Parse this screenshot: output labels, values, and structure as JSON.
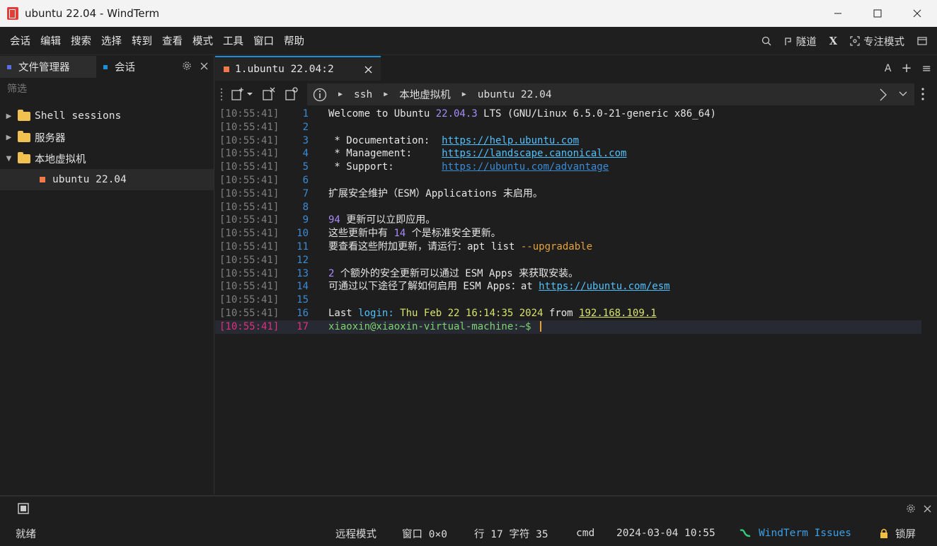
{
  "window": {
    "title": "ubuntu 22.04 - WindTerm"
  },
  "menu": {
    "items": [
      "会话",
      "编辑",
      "搜索",
      "选择",
      "转到",
      "查看",
      "模式",
      "工具",
      "窗口",
      "帮助"
    ],
    "tunnel_label": "隧道",
    "x_label": "X",
    "focus_label": "专注模式"
  },
  "left_panel": {
    "tabs": [
      {
        "label": "文件管理器",
        "color": "#5b6ee1"
      },
      {
        "label": "会话",
        "color": "#1f8fd6"
      }
    ],
    "filter_placeholder": "筛选",
    "tree": [
      {
        "label": "Shell sessions",
        "expanded": false
      },
      {
        "label": "服务器",
        "expanded": false
      },
      {
        "label": "本地虚拟机",
        "expanded": true
      },
      {
        "label": "ubuntu 22.04",
        "child": true
      }
    ]
  },
  "editor": {
    "tab_label": "1.ubuntu 22.04:2",
    "tabbar_right": {
      "font_label": "A",
      "add_label": "+",
      "menu_label": "≡"
    },
    "breadcrumb": [
      "ssh",
      "本地虚拟机",
      "ubuntu 22.04"
    ]
  },
  "terminal": {
    "timestamp": "[10:55:41]",
    "line_numbers": [
      "1",
      "2",
      "3",
      "4",
      "5",
      "6",
      "7",
      "8",
      "9",
      "10",
      "11",
      "12",
      "13",
      "14",
      "15",
      "16",
      "17"
    ],
    "l1": {
      "a": "Welcome to Ubuntu ",
      "ver": "22.04.3",
      "b": " LTS (GNU/Linux 6.5.0-21-generic x86_64)"
    },
    "l3": {
      "a": " * Documentation:  ",
      "link": "https://help.ubuntu.com"
    },
    "l4": {
      "a": " * Management:     ",
      "link": "https://landscape.canonical.com"
    },
    "l5": {
      "a": " * Support:        ",
      "link": "https://ubuntu.com/advantage"
    },
    "l7": "扩展安全维护（ESM）Applications 未启用。",
    "l9": {
      "num": "94",
      "b": " 更新可以立即应用。"
    },
    "l10": {
      "a": "这些更新中有 ",
      "num": "14",
      "b": " 个是标准安全更新。"
    },
    "l11": {
      "a": "要查看这些附加更新，请运行：apt list ",
      "flag": "--upgradable"
    },
    "l13": {
      "num": "2",
      "b": " 个额外的安全更新可以通过 ESM Apps 来获取安装。"
    },
    "l14": {
      "a": "可通过以下途径了解如何启用 ESM Apps：at ",
      "link": "https://ubuntu.com/esm"
    },
    "l16": {
      "a": "Last ",
      "kw1": "login",
      "b": ": ",
      "time": "Thu Feb 22 16:14:35 2024",
      "c": " from ",
      "ip": "192.168.109.1"
    },
    "l17": {
      "prompt": "xiaoxin@xiaoxin-virtual-machine",
      "tail": ":~$ "
    }
  },
  "status": {
    "ready": "就绪",
    "remote_mode": "远程模式",
    "window_size": "窗口 0×0",
    "cursor_pos": "行 17 字符 35",
    "shell": "cmd",
    "datetime": "2024-03-04 10:55",
    "issues_link": "WindTerm Issues",
    "lock": "锁屏"
  },
  "colors": {
    "accent": "#1f8fd6",
    "session_square": "#f07a4a",
    "current_line": "#e0307e",
    "folder": "#f0c150"
  }
}
